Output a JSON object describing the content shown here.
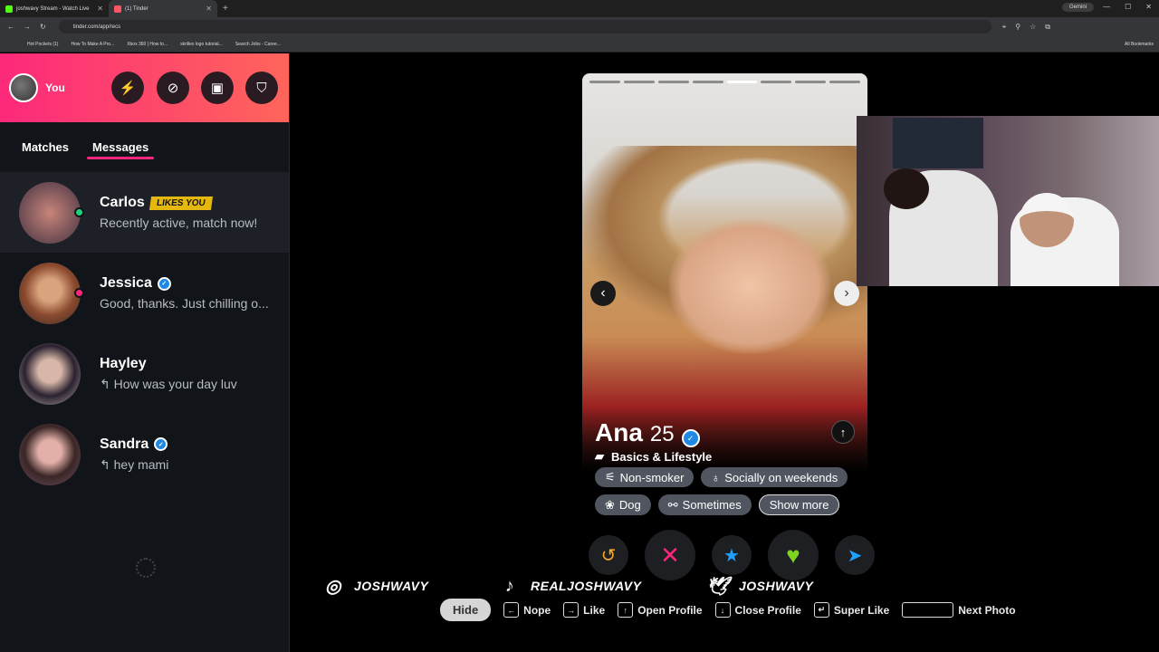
{
  "browser": {
    "tabs": [
      {
        "label": "joshwavy Stream - Watch Live",
        "favicon_color": "#53fc18"
      },
      {
        "label": "(1) Tinder",
        "favicon_color": "#fd5564"
      }
    ],
    "url": "tinder.com/app/recs",
    "gemini_label": "Gemini",
    "bookmarks": [
      "Hot Pockets (1)",
      "How To Make A Pro...",
      "Xbox 360 | How to...",
      "skrillex logo tutorial...",
      "Search Jobs - Caree..."
    ],
    "all_bookmarks": "All Bookmarks"
  },
  "sidebar": {
    "me_label": "You",
    "tabs": {
      "matches": "Matches",
      "messages": "Messages"
    },
    "conversations": [
      {
        "name": "Carlos",
        "badge": "LIKES YOU",
        "message": "Recently active, match now!",
        "status_color": "#21d07c",
        "verified": false
      },
      {
        "name": "Jessica",
        "message": "Good, thanks. Just chilling o...",
        "status_color": "#fd267a",
        "verified": true
      },
      {
        "name": "Hayley",
        "message": "How was your day luv",
        "verified": false,
        "replied": true
      },
      {
        "name": "Sandra",
        "message": "hey mami",
        "verified": true,
        "replied": true
      }
    ]
  },
  "card": {
    "name": "Ana",
    "age": "25",
    "section": "Basics & Lifestyle",
    "photo_count": 8,
    "active_photo": 5,
    "chips": [
      "Non-smoker",
      "Socially on weekends",
      "Dog",
      "Sometimes"
    ],
    "show_more": "Show more"
  },
  "social": [
    {
      "icon": "instagram-icon",
      "handle": "JOSHWAVY"
    },
    {
      "icon": "tiktok-icon",
      "handle": "REALJOSHWAVY"
    },
    {
      "icon": "twitter-icon",
      "handle": "JOSHWAVY"
    }
  ],
  "shortcuts": {
    "hide": "Hide",
    "nope": "Nope",
    "like": "Like",
    "open_profile": "Open Profile",
    "close_profile": "Close Profile",
    "super_like": "Super Like",
    "next_photo": "Next Photo"
  }
}
